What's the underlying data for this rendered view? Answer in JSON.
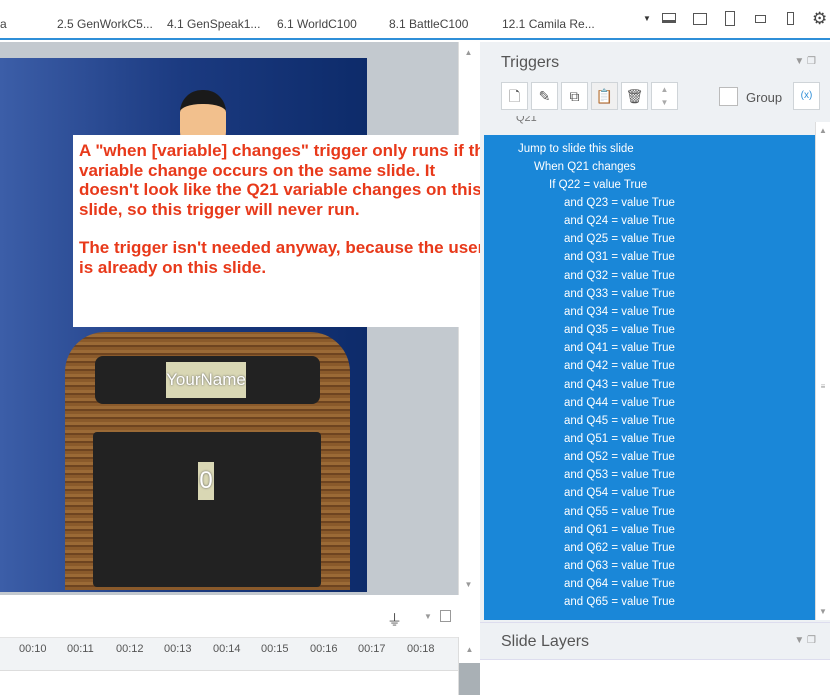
{
  "tabs": [
    "a",
    "2.5 GenWorkC5...",
    "4.1 GenSpeak1...",
    "6.1 WorldC100",
    "8.1 BattleC100",
    "12.1 Camila Re..."
  ],
  "slide": {
    "name_label": "YourName",
    "score": "0"
  },
  "callout": {
    "paragraph1": "A \"when [variable] changes\" trigger only runs if the variable change occurs on the same slide. It doesn't look like the Q21 variable changes on this slide, so this trigger will never run.",
    "paragraph2": "The trigger isn't needed anyway, because the user is already on this slide."
  },
  "triggers": {
    "title": "Triggers",
    "group_label": "Group",
    "partial_header": "Q21",
    "action": "Jump to slide this slide",
    "event": "When Q21 changes",
    "condition": "If Q22 = value True",
    "and_conditions": [
      "and Q23 = value True",
      "and Q24 = value True",
      "and Q25 = value True",
      "and Q31 = value True",
      "and Q32 = value True",
      "and Q33 = value True",
      "and Q34 = value True",
      "and Q35 = value True",
      "and Q41 = value True",
      "and Q42 = value True",
      "and Q43 = value True",
      "and Q44 = value True",
      "and Q45 = value True",
      "and Q51 = value True",
      "and Q52 = value True",
      "and Q53 = value True",
      "and Q54 = value True",
      "and Q55 = value True",
      "and Q61 = value True",
      "and Q62 = value True",
      "and Q63 = value True",
      "and Q64 = value True",
      "and Q65 = value True"
    ]
  },
  "slide_layers": {
    "title": "Slide Layers"
  },
  "timeline": {
    "ticks": [
      "00:10",
      "00:11",
      "00:12",
      "00:13",
      "00:14",
      "00:15",
      "00:16",
      "00:17",
      "00:18"
    ]
  },
  "colors": {
    "accent": "#1a87d8",
    "callout_text": "#e8391a"
  }
}
